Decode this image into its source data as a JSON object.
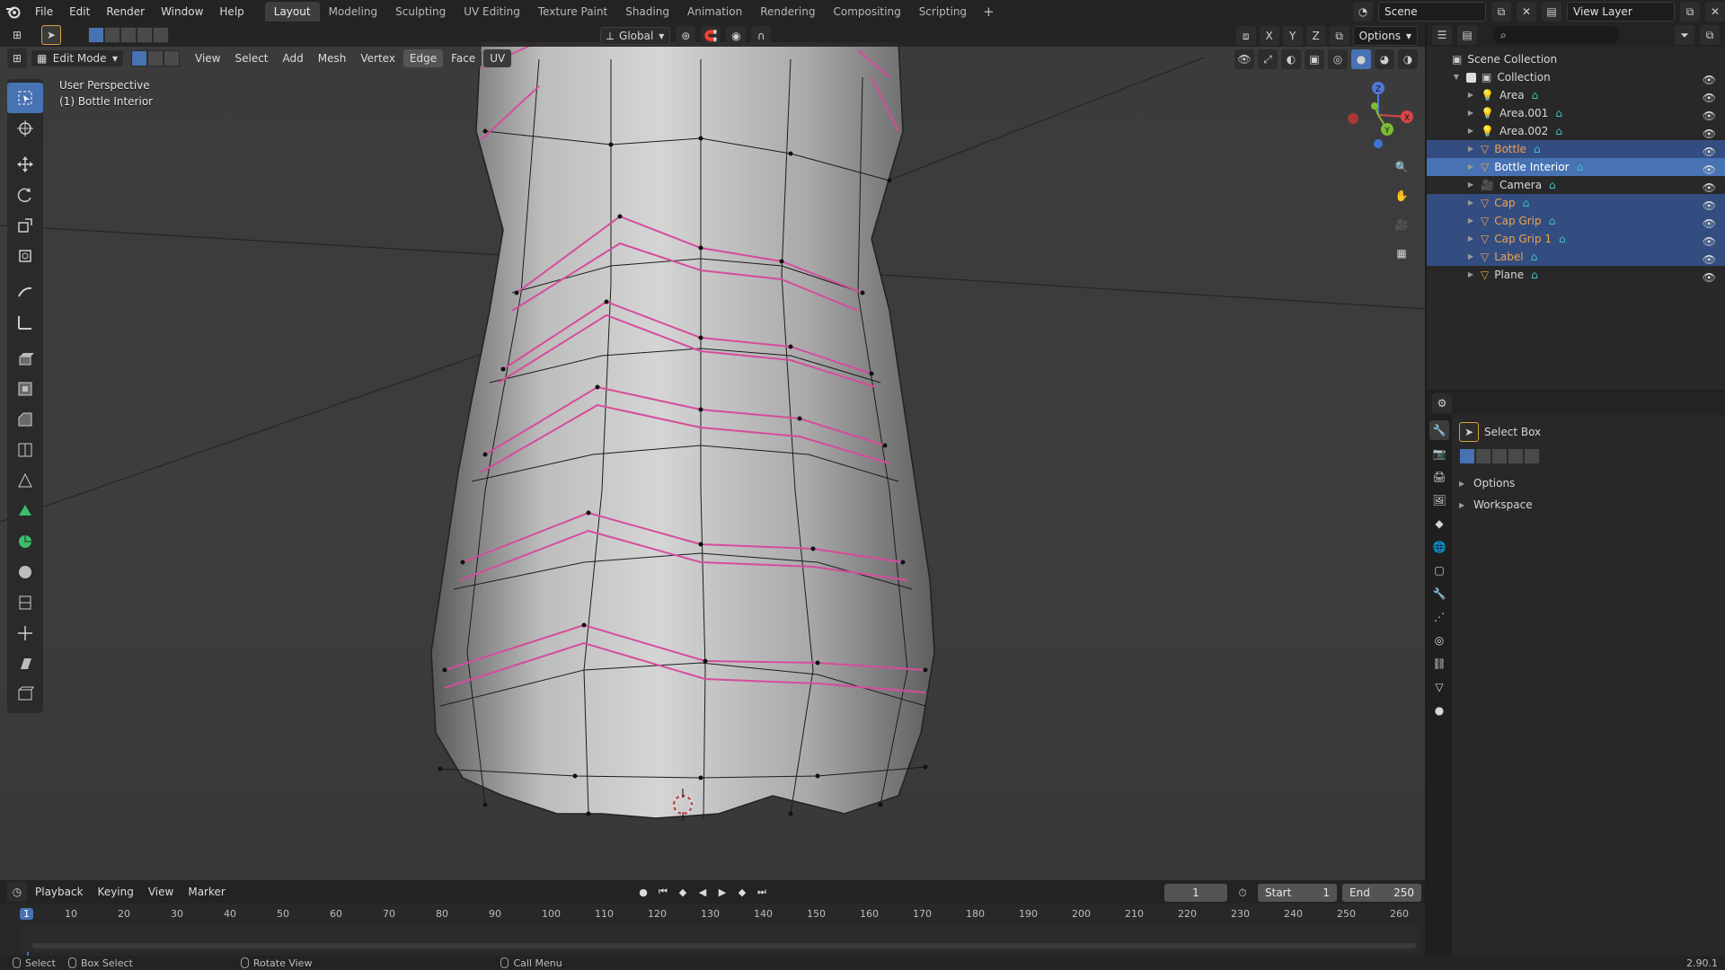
{
  "menu": [
    "File",
    "Edit",
    "Render",
    "Window",
    "Help"
  ],
  "workspaces": [
    "Layout",
    "Modeling",
    "Sculpting",
    "UV Editing",
    "Texture Paint",
    "Shading",
    "Animation",
    "Rendering",
    "Compositing",
    "Scripting"
  ],
  "active_workspace": "Layout",
  "scene_name": "Scene",
  "view_layer": "View Layer",
  "viewport": {
    "mode": "Edit Mode",
    "menus": [
      "View",
      "Select",
      "Add",
      "Mesh",
      "Vertex",
      "Edge",
      "Face",
      "UV"
    ],
    "active_select_menu": "Edge",
    "orientation": "Global",
    "axes": [
      "X",
      "Y",
      "Z"
    ],
    "options_label": "Options",
    "info_line1": "User Perspective",
    "info_line2": "(1) Bottle Interior"
  },
  "gizmo": {
    "x": "X",
    "y": "Y",
    "z": "Z"
  },
  "outliner": {
    "root": "Scene Collection",
    "collection": "Collection",
    "items": [
      {
        "name": "Area",
        "kind": "light",
        "state": "normal"
      },
      {
        "name": "Area.001",
        "kind": "light",
        "state": "normal"
      },
      {
        "name": "Area.002",
        "kind": "light",
        "state": "normal"
      },
      {
        "name": "Bottle",
        "kind": "mesh",
        "state": "selected"
      },
      {
        "name": "Bottle Interior",
        "kind": "mesh",
        "state": "active"
      },
      {
        "name": "Camera",
        "kind": "camera",
        "state": "normal"
      },
      {
        "name": "Cap",
        "kind": "mesh",
        "state": "selected"
      },
      {
        "name": "Cap Grip",
        "kind": "mesh",
        "state": "selected"
      },
      {
        "name": "Cap Grip 1",
        "kind": "mesh",
        "state": "selected"
      },
      {
        "name": "Label",
        "kind": "mesh",
        "state": "selected"
      },
      {
        "name": "Plane",
        "kind": "mesh",
        "state": "normal"
      }
    ]
  },
  "properties": {
    "tool_name": "Select Box",
    "panels": [
      "Options",
      "Workspace"
    ]
  },
  "timeline": {
    "menus": [
      "Playback",
      "Keying",
      "View",
      "Marker"
    ],
    "current_frame": "1",
    "start_label": "Start",
    "start": "1",
    "end_label": "End",
    "end": "250",
    "ticks": [
      "1",
      "10",
      "20",
      "30",
      "40",
      "50",
      "60",
      "70",
      "80",
      "90",
      "100",
      "110",
      "120",
      "130",
      "140",
      "150",
      "160",
      "170",
      "180",
      "190",
      "200",
      "210",
      "220",
      "230",
      "240",
      "250",
      "260"
    ]
  },
  "status": {
    "select": "Select",
    "box_select": "Box Select",
    "rotate": "Rotate View",
    "call_menu": "Call Menu",
    "version": "2.90.1"
  },
  "colors": {
    "accent": "#4772b3",
    "selected_row": "#334d80",
    "edge_select": "#d64c9c",
    "object_orange": "#f0a24a"
  }
}
